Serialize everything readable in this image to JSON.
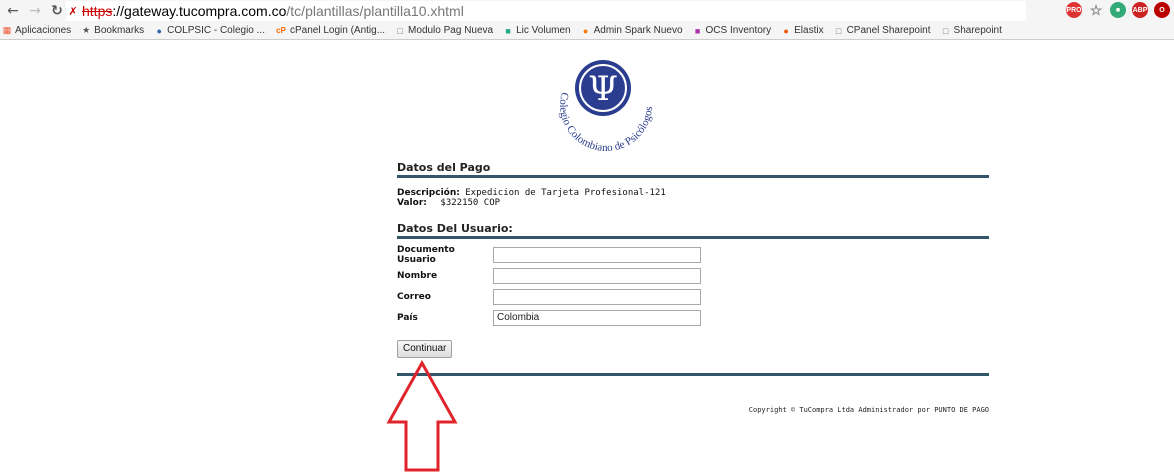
{
  "browser": {
    "url_scheme": "https",
    "url_host": "://gateway.tucompra.com.co",
    "url_path": "/tc/plantillas/plantilla10.xhtml",
    "bookmarks": [
      {
        "label": "Aplicaciones",
        "icon": "apps-grid-icon"
      },
      {
        "label": "Bookmarks",
        "icon": "star-icon"
      },
      {
        "label": "COLPSIC - Colegio ...",
        "icon": "colpsic-icon"
      },
      {
        "label": "cPanel Login (Antig...",
        "icon": "cpanel-icon"
      },
      {
        "label": "Modulo Pag Nueva",
        "icon": "page-icon"
      },
      {
        "label": "Lic Volumen",
        "icon": "windows-icon"
      },
      {
        "label": "Admin Spark Nuevo",
        "icon": "spark-icon"
      },
      {
        "label": "OCS Inventory",
        "icon": "ocs-icon"
      },
      {
        "label": "Elastix",
        "icon": "elastix-icon"
      },
      {
        "label": "CPanel Sharepoint",
        "icon": "page-icon"
      },
      {
        "label": "Sharepoint",
        "icon": "page-icon"
      }
    ],
    "extensions": [
      "pro",
      "abp"
    ]
  },
  "logo": {
    "text": "Colegio Colombiano de Psicólogos",
    "symbol": "Ψ"
  },
  "payment": {
    "title": "Datos del Pago",
    "description_label": "Descripción:",
    "description_value": "Expedicion de Tarjeta Profesional-121",
    "amount_label": "Valor:",
    "amount_value": "$322150 COP"
  },
  "user": {
    "title": "Datos Del Usuario:",
    "fields": [
      {
        "label": "Documento Usuario",
        "value": ""
      },
      {
        "label": "Nombre",
        "value": ""
      },
      {
        "label": "Correo",
        "value": ""
      },
      {
        "label": "País",
        "value": "Colombia"
      }
    ],
    "submit_label": "Continuar"
  },
  "footer": {
    "copyright": "Copyright © TuCompra Ltda Administrador por PUNTO DE PAGO"
  },
  "colors": {
    "rule": "#34566a",
    "logo_blue": "#2b3d8f",
    "arrow": "#e0242b"
  }
}
